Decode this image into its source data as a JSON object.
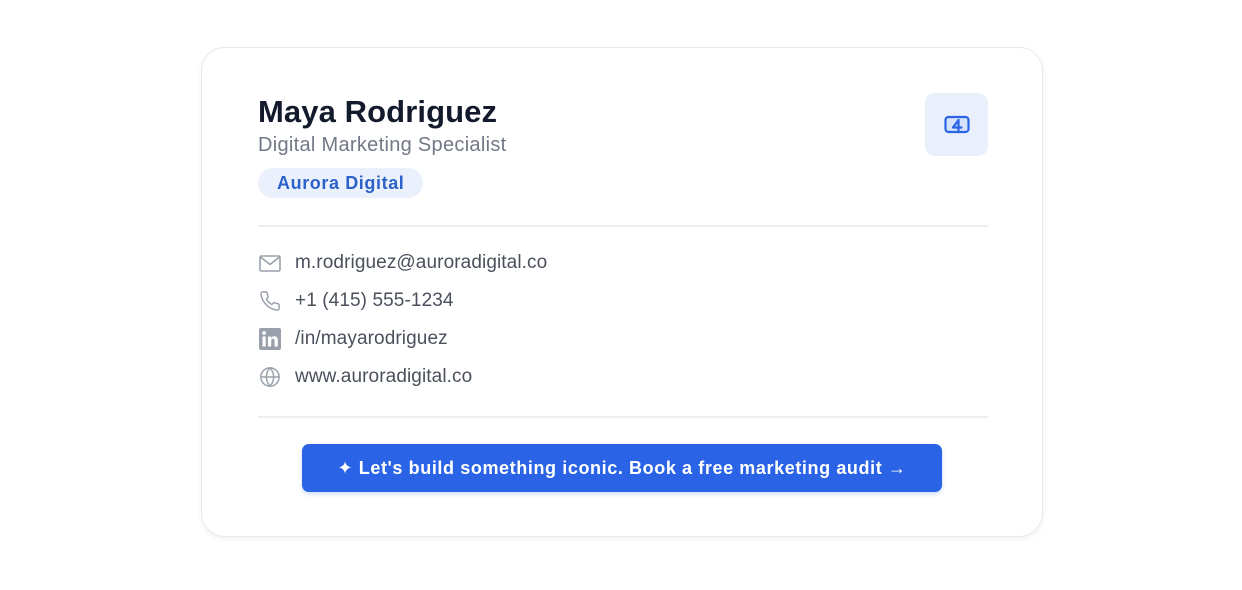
{
  "signature": {
    "name": "Maya Rodriguez",
    "title": "Digital Marketing Specialist",
    "company": "Aurora Digital",
    "logo_icon": "brand-logo-icon"
  },
  "contacts": [
    {
      "icon": "mail-icon",
      "text": "m.rodriguez@auroradigital.co"
    },
    {
      "icon": "phone-icon",
      "text": "+1 (415) 555-1234"
    },
    {
      "icon": "linkedin-icon",
      "text": "/in/mayarodriguez"
    },
    {
      "icon": "globe-icon",
      "text": "www.auroradigital.co"
    }
  ],
  "cta": {
    "label": "✦ Let's build something iconic. Book a free marketing audit →"
  },
  "colors": {
    "accent": "#2a63e6",
    "badge_bg": "#eaf1fc",
    "badge_text": "#2c62c9",
    "name_text": "#131a2b",
    "muted_text": "#727886",
    "contact_text": "#4a505c",
    "icon_gray": "#9aa0ab"
  }
}
